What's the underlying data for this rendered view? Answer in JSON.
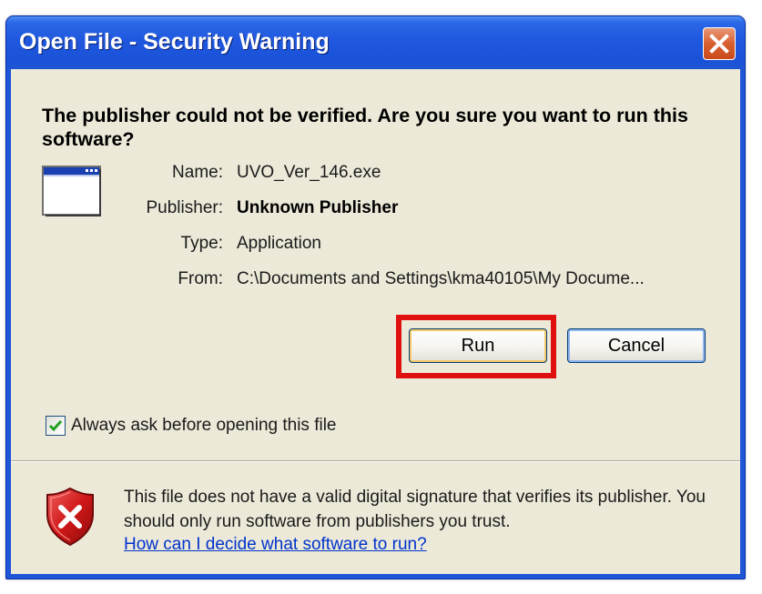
{
  "window": {
    "title": "Open File - Security Warning",
    "close_icon": "close-icon"
  },
  "dialog": {
    "heading": "The publisher could not be verified.  Are you sure you want to run this software?",
    "app_icon": "application-window-icon",
    "details": {
      "name_label": "Name:",
      "name_value": "UVO_Ver_146.exe",
      "publisher_label": "Publisher:",
      "publisher_value": "Unknown Publisher",
      "type_label": "Type:",
      "type_value": "Application",
      "from_label": "From:",
      "from_value": "C:\\Documents and Settings\\kma40105\\My Docume..."
    },
    "buttons": {
      "run_label": "Run",
      "cancel_label": "Cancel"
    },
    "checkbox": {
      "label": "Always ask before opening this file",
      "checked": true
    },
    "footer": {
      "shield_icon": "security-shield-icon",
      "message": "This file does not have a valid digital signature that verifies its publisher.  You should only run software from publishers you trust.",
      "link_text": "How can I decide what software to run?"
    }
  },
  "colors": {
    "titlebar": "#1f58df",
    "client_bg": "#ece9d8",
    "highlight": "#e01010",
    "link": "#0033cc",
    "close_button": "#d9602f"
  }
}
